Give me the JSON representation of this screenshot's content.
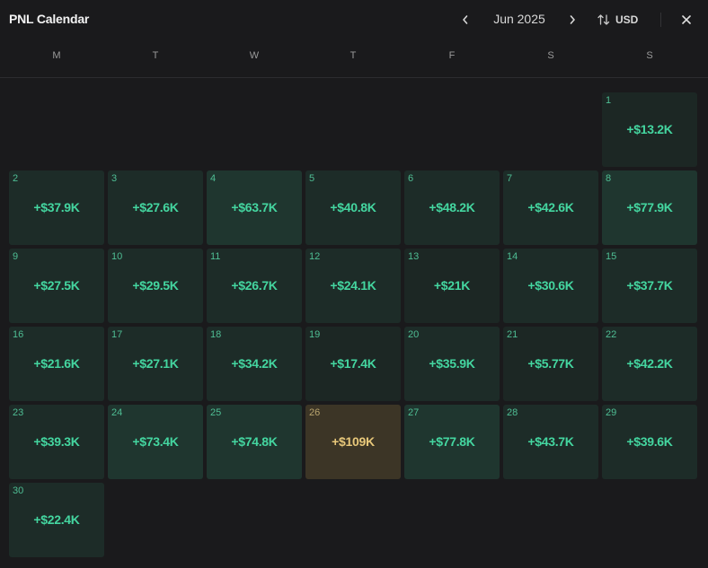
{
  "header": {
    "title": "PNL Calendar",
    "month_label": "Jun 2025",
    "currency_label": "USD"
  },
  "weekdays": [
    "M",
    "T",
    "W",
    "T",
    "F",
    "S",
    "S"
  ],
  "days": [
    {
      "day": "1",
      "value": "+$13.2K",
      "tone": "t1"
    },
    {
      "day": "2",
      "value": "+$37.9K",
      "tone": "t2"
    },
    {
      "day": "3",
      "value": "+$27.6K",
      "tone": "t2"
    },
    {
      "day": "4",
      "value": "+$63.7K",
      "tone": "t3"
    },
    {
      "day": "5",
      "value": "+$40.8K",
      "tone": "t2"
    },
    {
      "day": "6",
      "value": "+$48.2K",
      "tone": "t2"
    },
    {
      "day": "7",
      "value": "+$42.6K",
      "tone": "t2"
    },
    {
      "day": "8",
      "value": "+$77.9K",
      "tone": "t3"
    },
    {
      "day": "9",
      "value": "+$27.5K",
      "tone": "t2"
    },
    {
      "day": "10",
      "value": "+$29.5K",
      "tone": "t2"
    },
    {
      "day": "11",
      "value": "+$26.7K",
      "tone": "t2"
    },
    {
      "day": "12",
      "value": "+$24.1K",
      "tone": "t2"
    },
    {
      "day": "13",
      "value": "+$21K",
      "tone": "t1"
    },
    {
      "day": "14",
      "value": "+$30.6K",
      "tone": "t2"
    },
    {
      "day": "15",
      "value": "+$37.7K",
      "tone": "t2"
    },
    {
      "day": "16",
      "value": "+$21.6K",
      "tone": "t2"
    },
    {
      "day": "17",
      "value": "+$27.1K",
      "tone": "t2"
    },
    {
      "day": "18",
      "value": "+$34.2K",
      "tone": "t2"
    },
    {
      "day": "19",
      "value": "+$17.4K",
      "tone": "t1"
    },
    {
      "day": "20",
      "value": "+$35.9K",
      "tone": "t2"
    },
    {
      "day": "21",
      "value": "+$5.77K",
      "tone": "t1"
    },
    {
      "day": "22",
      "value": "+$42.2K",
      "tone": "t2"
    },
    {
      "day": "23",
      "value": "+$39.3K",
      "tone": "t2"
    },
    {
      "day": "24",
      "value": "+$73.4K",
      "tone": "t3"
    },
    {
      "day": "25",
      "value": "+$74.8K",
      "tone": "t3"
    },
    {
      "day": "26",
      "value": "+$109K",
      "tone": "gold"
    },
    {
      "day": "27",
      "value": "+$77.8K",
      "tone": "t3"
    },
    {
      "day": "28",
      "value": "+$43.7K",
      "tone": "t2"
    },
    {
      "day": "29",
      "value": "+$39.6K",
      "tone": "t2"
    },
    {
      "day": "30",
      "value": "+$22.4K",
      "tone": "t2"
    }
  ],
  "first_weekday_index": 6,
  "colors": {
    "background": "#1a1a1c",
    "positive_text": "#44d6a0",
    "top_day_text": "#e8c87a"
  },
  "icons": {
    "prev": "chevron-left-icon",
    "next": "chevron-right-icon",
    "currency": "sort-arrows-icon",
    "close": "close-icon"
  }
}
